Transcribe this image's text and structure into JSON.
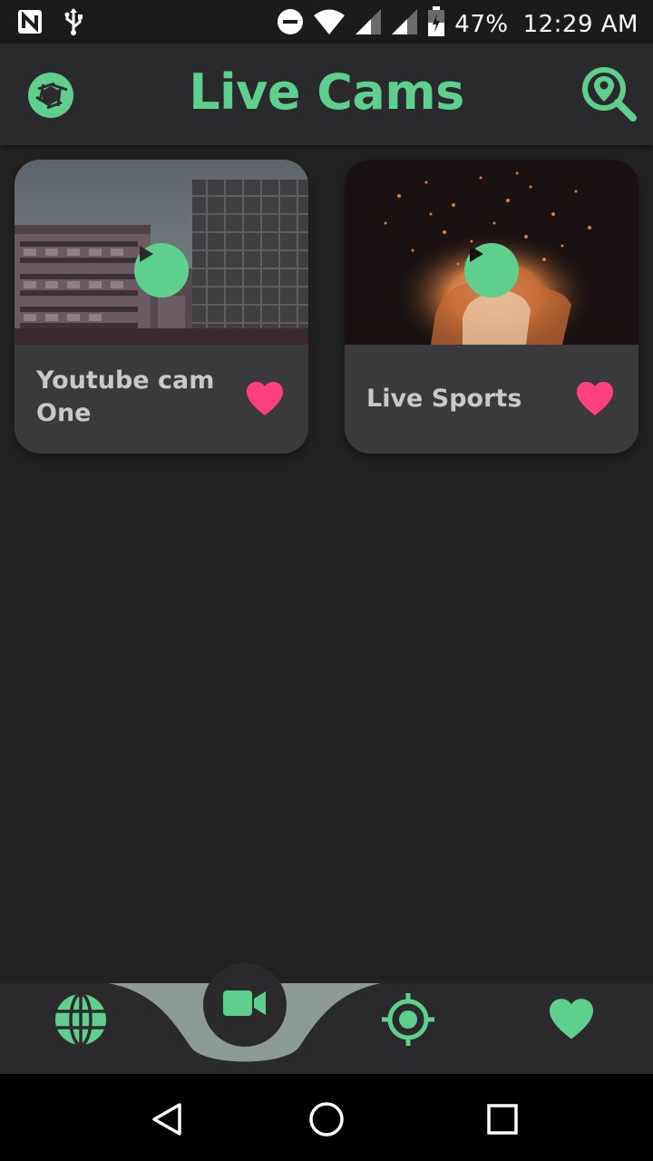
{
  "status_bar": {
    "battery": "47%",
    "time": "12:29 AM",
    "icons": [
      "n-notification-icon",
      "usb-icon",
      "do-not-disturb-icon",
      "wifi-icon",
      "signal-icon",
      "signal-icon-2",
      "battery-icon"
    ]
  },
  "app_bar": {
    "title": "Live Cams",
    "logo_icon": "camera-shutter-icon",
    "search_icon": "location-search-icon"
  },
  "cams": [
    {
      "title": "Youtube cam One",
      "thumbnail": "city-buildings-image",
      "favorite": true
    },
    {
      "title": "Live Sports",
      "thumbnail": "fire-sparks-image",
      "favorite": true
    }
  ],
  "bottom_nav": {
    "items": [
      "globe-icon",
      "video-camera-icon",
      "crosshair-icon",
      "heart-icon"
    ],
    "active": "video-camera-icon"
  },
  "system_nav": [
    "back-icon",
    "home-icon",
    "recents-icon"
  ],
  "colors": {
    "accent": "#5ecf8d",
    "favorite": "#ff3f7f",
    "background": "#222223",
    "app_bar": "#2a2a2d",
    "card": "#3a3a3d"
  }
}
